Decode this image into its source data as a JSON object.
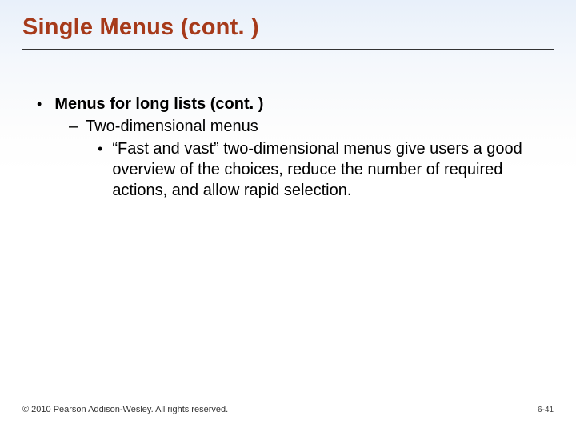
{
  "title": "Single Menus (cont. )",
  "bullets": {
    "l1": {
      "marker": "•",
      "text": "Menus for long lists (cont. )"
    },
    "l2": {
      "marker": "–",
      "text": "Two-dimensional menus"
    },
    "l3": {
      "marker": "•",
      "text": "“Fast and vast” two-dimensional menus give users a good overview of the choices, reduce the number of required actions, and allow rapid selection."
    }
  },
  "footer": {
    "copyright": "© 2010 Pearson Addison-Wesley. All rights reserved.",
    "page": "6-41"
  }
}
